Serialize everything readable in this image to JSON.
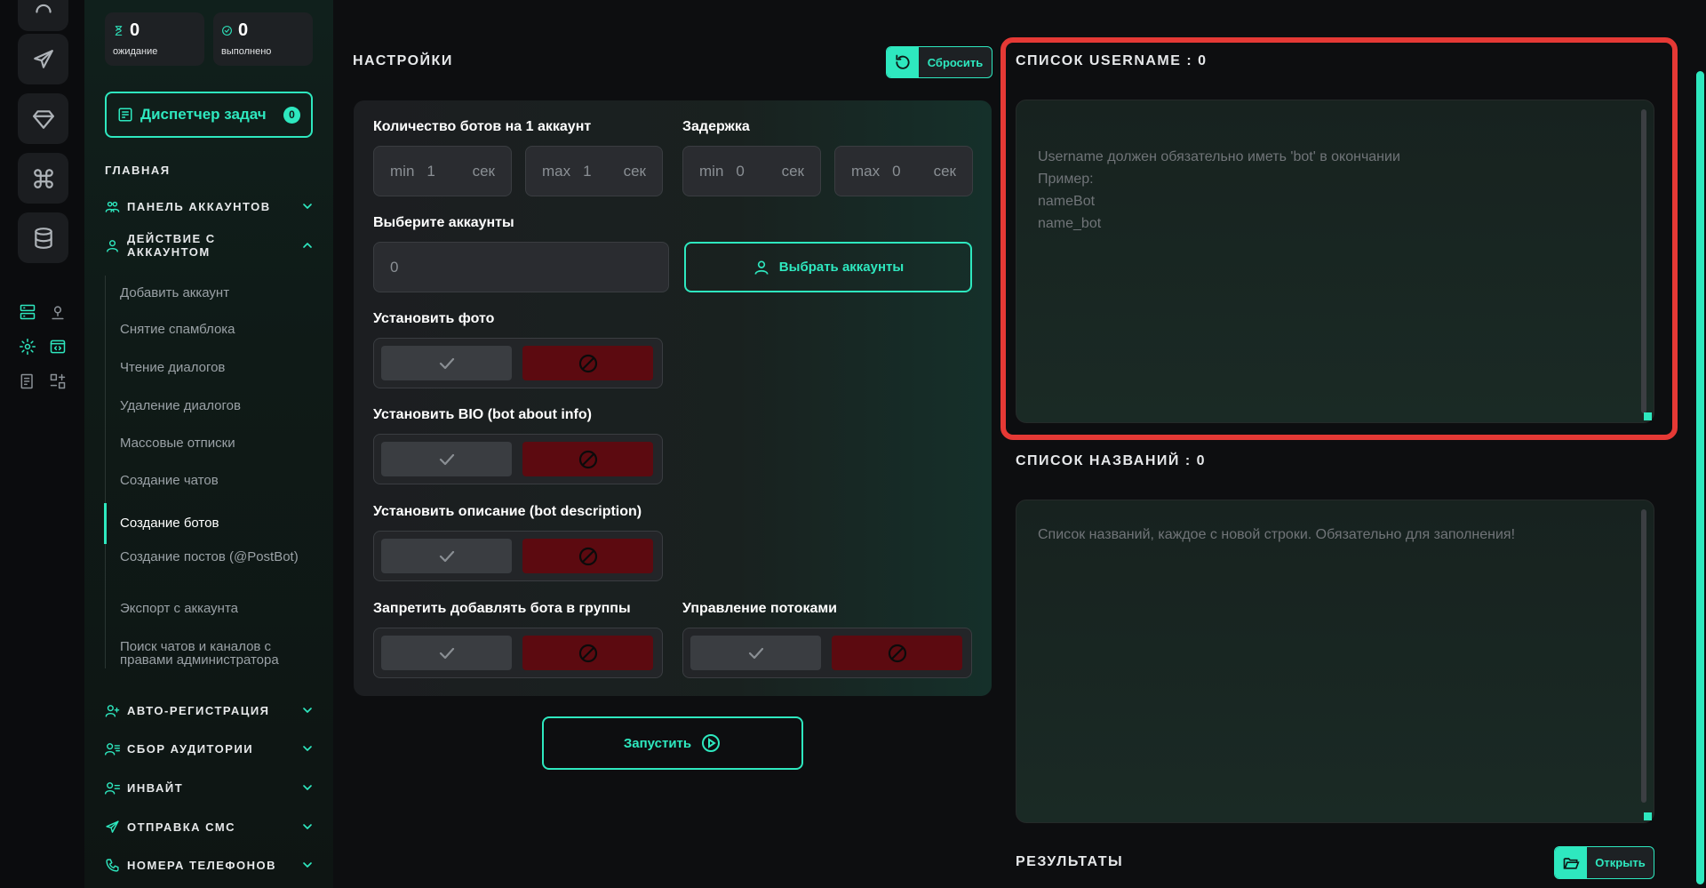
{
  "stats": {
    "pending": {
      "value": "0",
      "label": "ожидание"
    },
    "done": {
      "value": "0",
      "label": "выполнено"
    }
  },
  "dispatcher": {
    "label": "Диспетчер задач",
    "count": "0"
  },
  "sidebar": {
    "section": "ГЛАВНАЯ",
    "groups_top": [
      {
        "label": "ПАНЕЛЬ АККАУНТОВ"
      },
      {
        "label": "ДЕЙСТВИЕ С АККАУНТОМ"
      }
    ],
    "sub_items": [
      "Добавить аккаунт",
      "Снятие спамблока",
      "Чтение диалогов",
      "Удаление диалогов",
      "Массовые отписки",
      "Создание чатов",
      "Создание ботов",
      "Создание постов (@PostBot)",
      "Экспорт с аккаунта",
      "Поиск чатов и каналов с правами администратора"
    ],
    "active_item": "Создание ботов",
    "groups_bottom": [
      {
        "label": "АВТО-РЕГИСТРАЦИЯ"
      },
      {
        "label": "СБОР АУДИТОРИИ"
      },
      {
        "label": "ИНВАЙТ"
      },
      {
        "label": "ОТПРАВКА СМС"
      },
      {
        "label": "НОМЕРА ТЕЛЕФОНОВ"
      }
    ]
  },
  "settings": {
    "title": "НАСТРОЙКИ",
    "reset_label": "Сбросить",
    "bots_per_account": {
      "label": "Количество ботов на 1 аккаунт",
      "min": {
        "prefix": "min",
        "value": "1",
        "unit": "сек"
      },
      "max": {
        "prefix": "max",
        "value": "1",
        "unit": "сек"
      }
    },
    "delay": {
      "label": "Задержка",
      "min": {
        "prefix": "min",
        "value": "0",
        "unit": "сек"
      },
      "max": {
        "prefix": "max",
        "value": "0",
        "unit": "сек"
      }
    },
    "accounts": {
      "label": "Выберите аккаунты",
      "value": "0",
      "button": "Выбрать аккаунты"
    },
    "set_photo": {
      "label": "Установить фото",
      "state": "off"
    },
    "set_bio": {
      "label": "Установить BIO (bot about info)",
      "state": "off"
    },
    "set_description": {
      "label": "Установить описание (bot description)",
      "state": "off"
    },
    "forbid_groups": {
      "label": "Запретить добавлять бота в группы",
      "state": "off"
    },
    "threads": {
      "label": "Управление потоками",
      "state": "off"
    },
    "start_label": "Запустить"
  },
  "usernames": {
    "title": "СПИСОК USERNAME : 0",
    "placeholder": "Username должен обязательно иметь 'bot' в окончании\nПример:\nnameBot\nname_bot"
  },
  "names": {
    "title": "СПИСОК НАЗВАНИЙ : 0",
    "placeholder": "Список названий, каждое с новой строки. Обязательно для заполнения!"
  },
  "results": {
    "title": "РЕЗУЛЬТАТЫ",
    "open_label": "Открыть"
  },
  "colors": {
    "accent": "#2ee8bf",
    "danger": "#5c0a10",
    "highlight": "#e53935"
  }
}
